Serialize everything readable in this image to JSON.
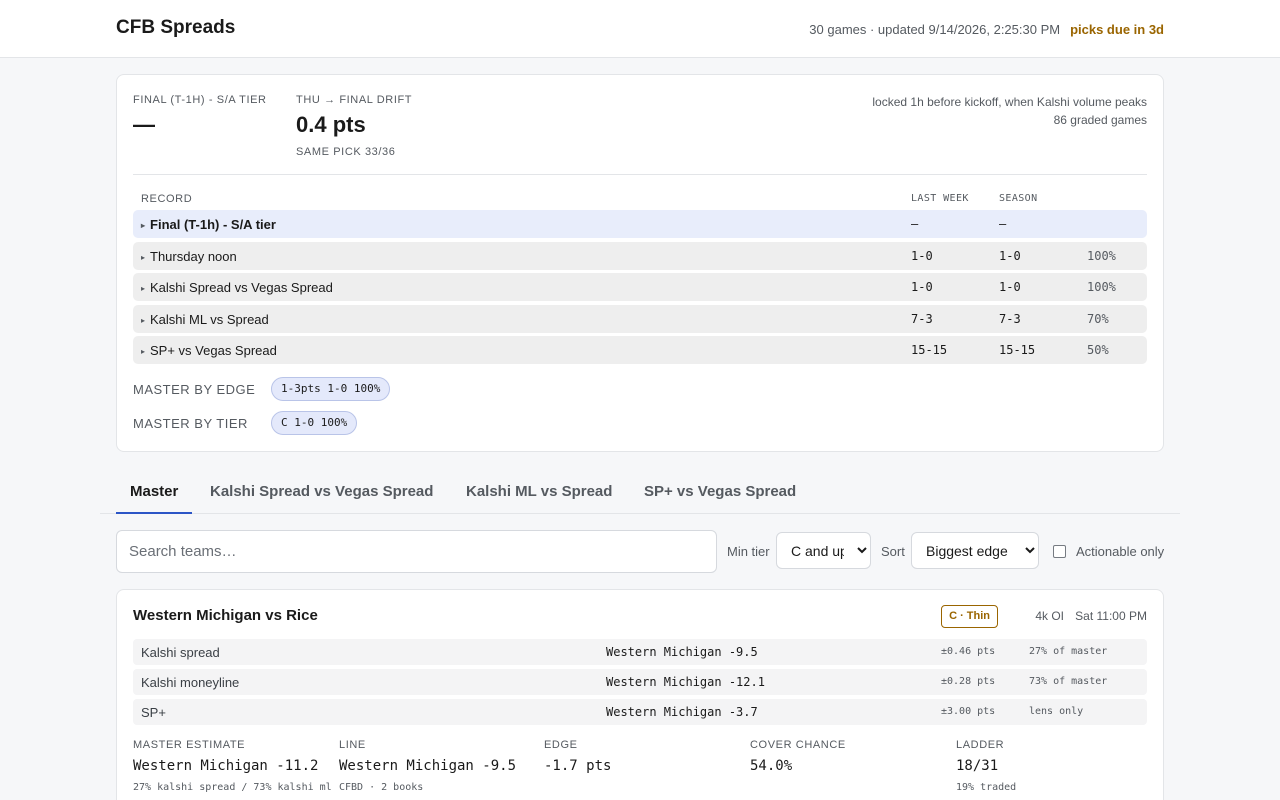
{
  "app": {
    "title": "CFB Spreads",
    "meta": "30 games · updated 9/14/2026, 2:25:30 PM",
    "due": "picks due in 3d"
  },
  "summary": {
    "final_label": "FINAL (T-1H) - S/A TIER",
    "final_value": "—",
    "drift_label": "THU → FINAL DRIFT",
    "drift_value": "0.4 pts",
    "drift_sub": "SAME PICK 33/36",
    "lock_note_1": "locked 1h before kickoff, when Kalshi volume peaks",
    "lock_note_2": "86 graded games"
  },
  "record": {
    "header": "RECORD",
    "col_last_week": "LAST WEEK",
    "col_season": "SEASON",
    "rows": [
      {
        "name": "Final (T-1h) - S/A tier",
        "last_week": "–",
        "season": "–",
        "pct": ""
      },
      {
        "name": "Thursday noon",
        "last_week": "1-0",
        "season": "1-0",
        "pct": "100%"
      },
      {
        "name": "Kalshi Spread vs Vegas Spread",
        "last_week": "1-0",
        "season": "1-0",
        "pct": "100%"
      },
      {
        "name": "Kalshi ML vs Spread",
        "last_week": "7-3",
        "season": "7-3",
        "pct": "70%"
      },
      {
        "name": "SP+ vs Vegas Spread",
        "last_week": "15-15",
        "season": "15-15",
        "pct": "50%"
      }
    ]
  },
  "master_by_edge": {
    "label": "MASTER BY EDGE",
    "pill": "1-3pts 1-0 100%"
  },
  "master_by_tier": {
    "label": "MASTER BY TIER",
    "pill": "C 1-0 100%"
  },
  "tabs": [
    {
      "label": "Master",
      "active": true
    },
    {
      "label": "Kalshi Spread vs Vegas Spread",
      "active": false
    },
    {
      "label": "Kalshi ML vs Spread",
      "active": false
    },
    {
      "label": "SP+ vs Vegas Spread",
      "active": false
    }
  ],
  "filters": {
    "search_placeholder": "Search teams…",
    "min_tier_label": "Min tier",
    "min_tier_value": "C and up",
    "sort_label": "Sort",
    "sort_value": "Biggest edge",
    "actionable_label": "Actionable only"
  },
  "game": {
    "title": "Western Michigan vs Rice",
    "tier": "C · Thin",
    "oi": "4k OI",
    "kickoff": "Sat 11:00 PM",
    "sources": [
      {
        "name": "Kalshi spread",
        "value": "Western Michigan -9.5",
        "err": "±0.46 pts",
        "weight": "27% of master"
      },
      {
        "name": "Kalshi moneyline",
        "value": "Western Michigan -12.1",
        "err": "±0.28 pts",
        "weight": "73% of master"
      },
      {
        "name": "SP+",
        "value": "Western Michigan -3.7",
        "err": "±3.00 pts",
        "weight": "lens only"
      }
    ],
    "estimate": {
      "label": "MASTER ESTIMATE",
      "value": "Western Michigan -11.2",
      "note": "27% kalshi spread / 73% kalshi ml"
    },
    "line": {
      "label": "LINE",
      "value": "Western Michigan -9.5",
      "note": "CFBD · 2 books"
    },
    "edge": {
      "label": "EDGE",
      "value": "-1.7 pts"
    },
    "cover": {
      "label": "COVER CHANCE",
      "value": "54.0%"
    },
    "ladder": {
      "label": "LADDER",
      "value": "18/31",
      "note": "19% traded"
    }
  }
}
